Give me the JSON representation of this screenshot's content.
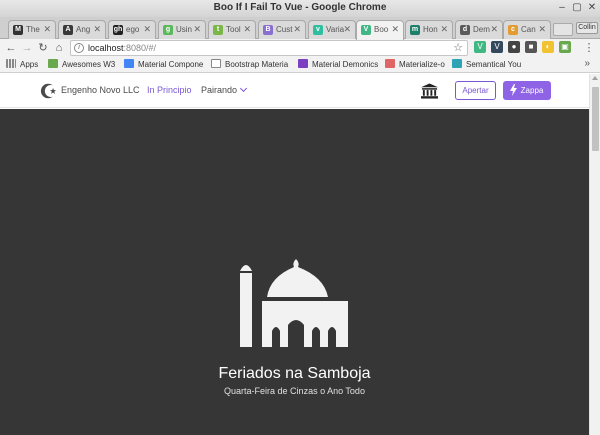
{
  "window": {
    "title": "Boo If I Fail To Vue - Google Chrome"
  },
  "tabs": [
    {
      "label": "The",
      "icon": "M",
      "color": "#333333"
    },
    {
      "label": "Ang",
      "icon": "A",
      "color": "#3a3a3a"
    },
    {
      "label": "ego",
      "icon": "gh",
      "color": "#222222"
    },
    {
      "label": "Usin",
      "icon": "g",
      "color": "#5cb85c"
    },
    {
      "label": "Tool",
      "icon": "t",
      "color": "#7ab648"
    },
    {
      "label": "Cust",
      "icon": "B",
      "color": "#8a6fd1"
    },
    {
      "label": "Varia",
      "icon": "v",
      "color": "#2fbf9e"
    },
    {
      "label": "Boo",
      "icon": "V",
      "color": "#41b883"
    },
    {
      "label": "Hon",
      "icon": "m",
      "color": "#1e7f6a"
    },
    {
      "label": "Dem",
      "icon": "d",
      "color": "#5a5a5a"
    },
    {
      "label": "Can",
      "icon": "c",
      "color": "#e39b32"
    }
  ],
  "profile_label": "Collin",
  "address_bar": {
    "host": "localhost",
    "path": ":8080/#/"
  },
  "bookmarks": [
    {
      "label": "Apps",
      "color": "#888888"
    },
    {
      "label": "Awesomes W3",
      "color": "#6aa84f"
    },
    {
      "label": "Material Compone",
      "color": "#4285f4"
    },
    {
      "label": "Bootstrap Materia",
      "color": "#888888"
    },
    {
      "label": "Material Demonics",
      "color": "#7b3fbf"
    },
    {
      "label": "Materialize-o",
      "color": "#e06666"
    },
    {
      "label": "Semantical You",
      "color": "#2ea3b5"
    }
  ],
  "navbar": {
    "brand": "Engenho Novo LLC",
    "link_active": "In Principio",
    "link_dropdown": "Pairando",
    "btn_outline": "Apertar",
    "btn_primary": "Zappa"
  },
  "hero": {
    "title": "Feriados na Samboja",
    "subtitle": "Quarta-Feira de Cinzas o Ano Todo"
  },
  "colors": {
    "accent": "#7957d5",
    "hero_bg": "#363636",
    "primary_btn": "#8e63e5"
  }
}
